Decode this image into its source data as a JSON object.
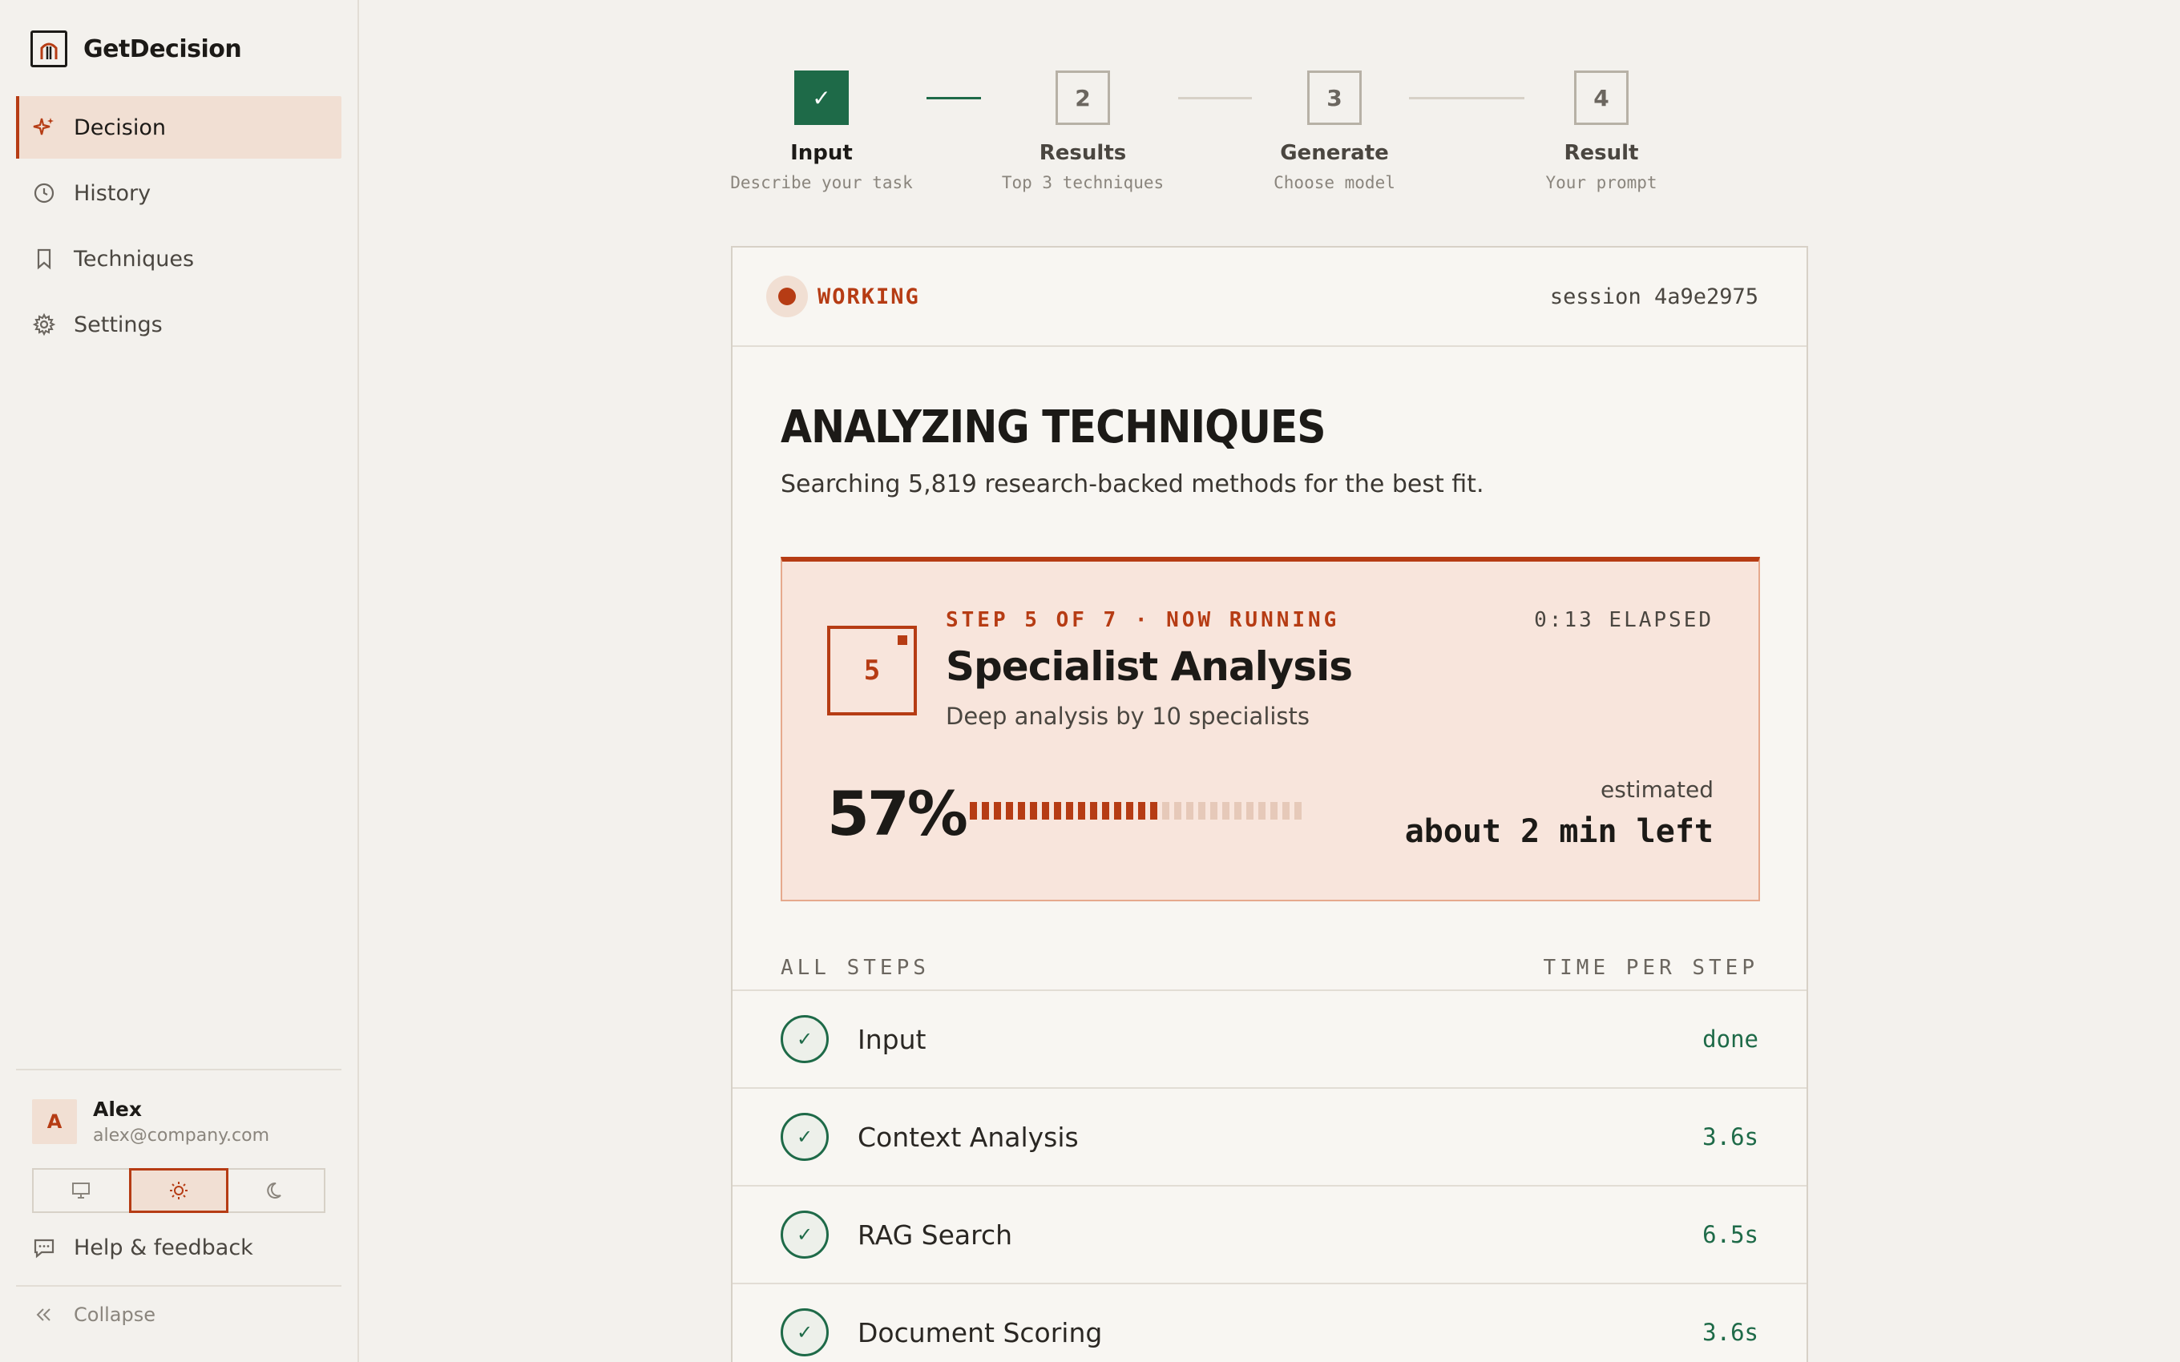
{
  "app": {
    "name": "GetDecision"
  },
  "sidebar": {
    "items": [
      {
        "label": "Decision",
        "icon": "sparkle-icon",
        "active": true
      },
      {
        "label": "History",
        "icon": "clock-icon",
        "active": false
      },
      {
        "label": "Techniques",
        "icon": "bookmark-icon",
        "active": false
      },
      {
        "label": "Settings",
        "icon": "gear-icon",
        "active": false
      }
    ],
    "user": {
      "initial": "A",
      "name": "Alex",
      "email": "alex@company.com"
    },
    "theme": {
      "options": [
        "monitor-icon",
        "sun-icon",
        "moon-icon"
      ],
      "selected": "sun-icon"
    },
    "help_label": "Help & feedback",
    "collapse_label": "Collapse"
  },
  "stepper": {
    "steps": [
      {
        "number": "✓",
        "title": "Input",
        "subtitle": "Describe your task",
        "done": true
      },
      {
        "number": "2",
        "title": "Results",
        "subtitle": "Top 3 techniques",
        "done": false
      },
      {
        "number": "3",
        "title": "Generate",
        "subtitle": "Choose model",
        "done": false
      },
      {
        "number": "4",
        "title": "Result",
        "subtitle": "Your prompt",
        "done": false
      }
    ]
  },
  "card": {
    "status": "WORKING",
    "session": "session 4a9e2975",
    "heading": "ANALYZING TECHNIQUES",
    "subheading": "Searching 5,819 research-backed methods for the best fit.",
    "current": {
      "number": "5",
      "eyebrow": "STEP 5 OF 7 · NOW RUNNING",
      "elapsed": "0:13 ELAPSED",
      "title": "Specialist Analysis",
      "description": "Deep analysis by 10 specialists",
      "percent_label": "57%",
      "progress_percent": 57,
      "estimate_label": "estimated",
      "estimate": "about 2 min left"
    },
    "list": {
      "title": "ALL STEPS",
      "time_header": "TIME PER STEP",
      "rows": [
        {
          "name": "Input",
          "time": "done"
        },
        {
          "name": "Context Analysis",
          "time": "3.6s"
        },
        {
          "name": "RAG Search",
          "time": "6.5s"
        },
        {
          "name": "Document Scoring",
          "time": "3.6s"
        }
      ]
    }
  },
  "colors": {
    "accent": "#b63c14",
    "success": "#1e6a48",
    "background": "#f3f1ed"
  }
}
